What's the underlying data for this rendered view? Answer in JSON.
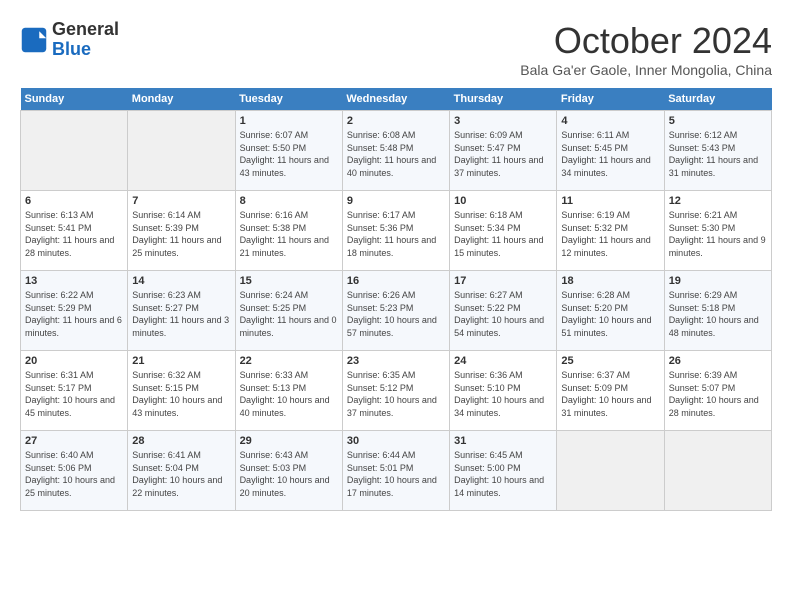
{
  "header": {
    "logo_line1": "General",
    "logo_line2": "Blue",
    "month": "October 2024",
    "location": "Bala Ga'er Gaole, Inner Mongolia, China"
  },
  "days_of_week": [
    "Sunday",
    "Monday",
    "Tuesday",
    "Wednesday",
    "Thursday",
    "Friday",
    "Saturday"
  ],
  "weeks": [
    [
      {
        "day": "",
        "info": ""
      },
      {
        "day": "",
        "info": ""
      },
      {
        "day": "1",
        "sunrise": "6:07 AM",
        "sunset": "5:50 PM",
        "daylight": "11 hours and 43 minutes."
      },
      {
        "day": "2",
        "sunrise": "6:08 AM",
        "sunset": "5:48 PM",
        "daylight": "11 hours and 40 minutes."
      },
      {
        "day": "3",
        "sunrise": "6:09 AM",
        "sunset": "5:47 PM",
        "daylight": "11 hours and 37 minutes."
      },
      {
        "day": "4",
        "sunrise": "6:11 AM",
        "sunset": "5:45 PM",
        "daylight": "11 hours and 34 minutes."
      },
      {
        "day": "5",
        "sunrise": "6:12 AM",
        "sunset": "5:43 PM",
        "daylight": "11 hours and 31 minutes."
      }
    ],
    [
      {
        "day": "6",
        "sunrise": "6:13 AM",
        "sunset": "5:41 PM",
        "daylight": "11 hours and 28 minutes."
      },
      {
        "day": "7",
        "sunrise": "6:14 AM",
        "sunset": "5:39 PM",
        "daylight": "11 hours and 25 minutes."
      },
      {
        "day": "8",
        "sunrise": "6:16 AM",
        "sunset": "5:38 PM",
        "daylight": "11 hours and 21 minutes."
      },
      {
        "day": "9",
        "sunrise": "6:17 AM",
        "sunset": "5:36 PM",
        "daylight": "11 hours and 18 minutes."
      },
      {
        "day": "10",
        "sunrise": "6:18 AM",
        "sunset": "5:34 PM",
        "daylight": "11 hours and 15 minutes."
      },
      {
        "day": "11",
        "sunrise": "6:19 AM",
        "sunset": "5:32 PM",
        "daylight": "11 hours and 12 minutes."
      },
      {
        "day": "12",
        "sunrise": "6:21 AM",
        "sunset": "5:30 PM",
        "daylight": "11 hours and 9 minutes."
      }
    ],
    [
      {
        "day": "13",
        "sunrise": "6:22 AM",
        "sunset": "5:29 PM",
        "daylight": "11 hours and 6 minutes."
      },
      {
        "day": "14",
        "sunrise": "6:23 AM",
        "sunset": "5:27 PM",
        "daylight": "11 hours and 3 minutes."
      },
      {
        "day": "15",
        "sunrise": "6:24 AM",
        "sunset": "5:25 PM",
        "daylight": "11 hours and 0 minutes."
      },
      {
        "day": "16",
        "sunrise": "6:26 AM",
        "sunset": "5:23 PM",
        "daylight": "10 hours and 57 minutes."
      },
      {
        "day": "17",
        "sunrise": "6:27 AM",
        "sunset": "5:22 PM",
        "daylight": "10 hours and 54 minutes."
      },
      {
        "day": "18",
        "sunrise": "6:28 AM",
        "sunset": "5:20 PM",
        "daylight": "10 hours and 51 minutes."
      },
      {
        "day": "19",
        "sunrise": "6:29 AM",
        "sunset": "5:18 PM",
        "daylight": "10 hours and 48 minutes."
      }
    ],
    [
      {
        "day": "20",
        "sunrise": "6:31 AM",
        "sunset": "5:17 PM",
        "daylight": "10 hours and 45 minutes."
      },
      {
        "day": "21",
        "sunrise": "6:32 AM",
        "sunset": "5:15 PM",
        "daylight": "10 hours and 43 minutes."
      },
      {
        "day": "22",
        "sunrise": "6:33 AM",
        "sunset": "5:13 PM",
        "daylight": "10 hours and 40 minutes."
      },
      {
        "day": "23",
        "sunrise": "6:35 AM",
        "sunset": "5:12 PM",
        "daylight": "10 hours and 37 minutes."
      },
      {
        "day": "24",
        "sunrise": "6:36 AM",
        "sunset": "5:10 PM",
        "daylight": "10 hours and 34 minutes."
      },
      {
        "day": "25",
        "sunrise": "6:37 AM",
        "sunset": "5:09 PM",
        "daylight": "10 hours and 31 minutes."
      },
      {
        "day": "26",
        "sunrise": "6:39 AM",
        "sunset": "5:07 PM",
        "daylight": "10 hours and 28 minutes."
      }
    ],
    [
      {
        "day": "27",
        "sunrise": "6:40 AM",
        "sunset": "5:06 PM",
        "daylight": "10 hours and 25 minutes."
      },
      {
        "day": "28",
        "sunrise": "6:41 AM",
        "sunset": "5:04 PM",
        "daylight": "10 hours and 22 minutes."
      },
      {
        "day": "29",
        "sunrise": "6:43 AM",
        "sunset": "5:03 PM",
        "daylight": "10 hours and 20 minutes."
      },
      {
        "day": "30",
        "sunrise": "6:44 AM",
        "sunset": "5:01 PM",
        "daylight": "10 hours and 17 minutes."
      },
      {
        "day": "31",
        "sunrise": "6:45 AM",
        "sunset": "5:00 PM",
        "daylight": "10 hours and 14 minutes."
      },
      {
        "day": "",
        "info": ""
      },
      {
        "day": "",
        "info": ""
      }
    ]
  ]
}
